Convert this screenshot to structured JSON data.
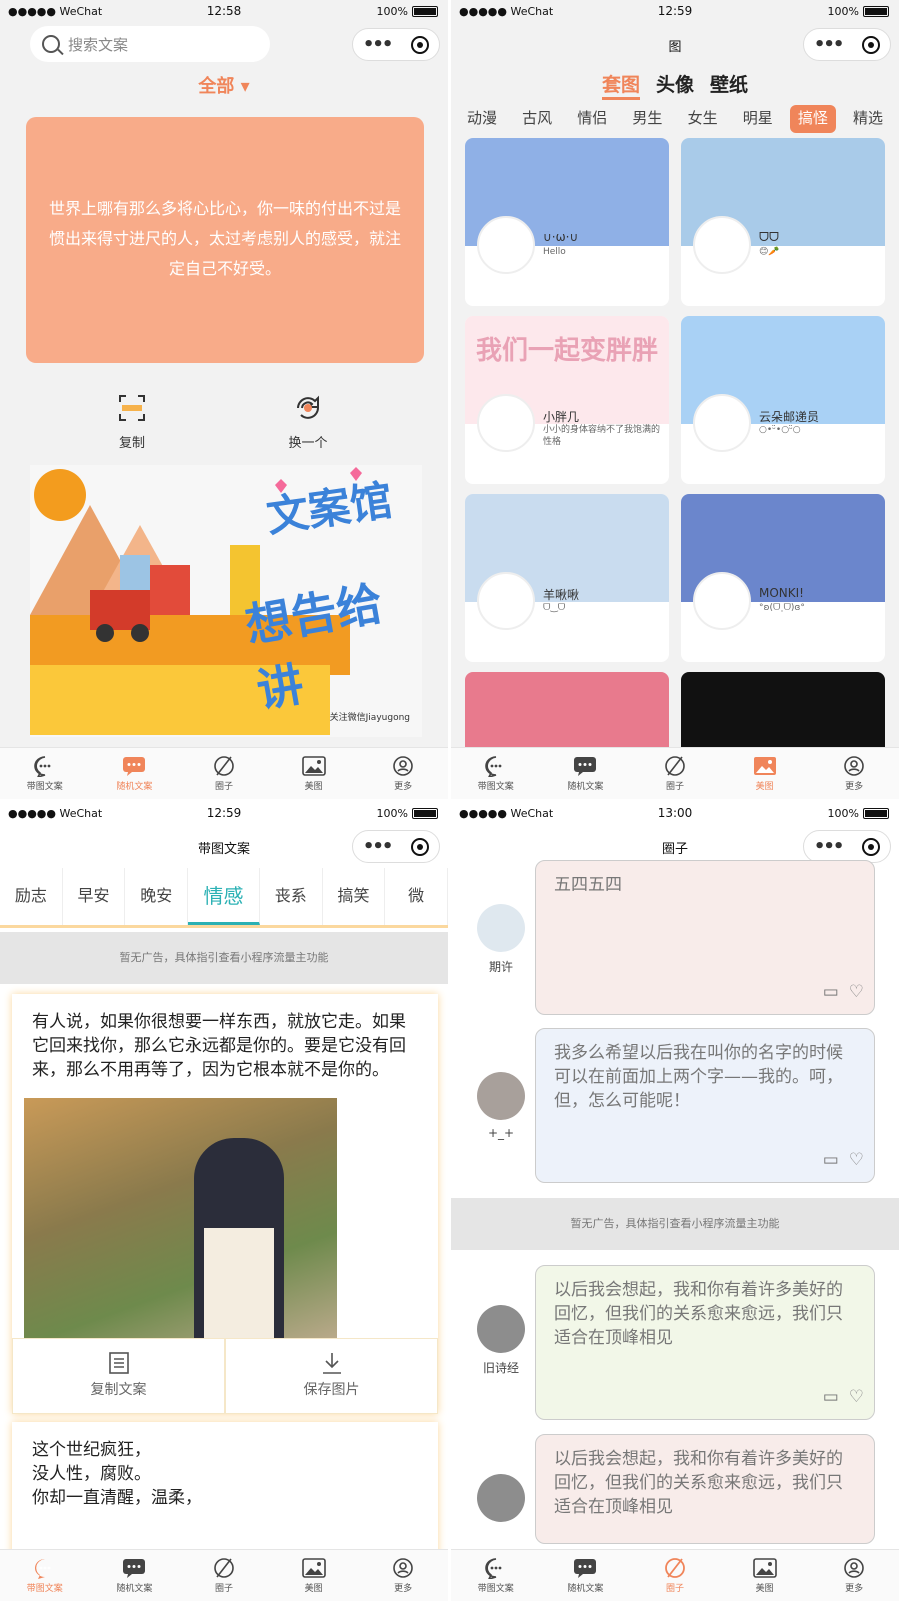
{
  "status": {
    "p1": {
      "signal": "●●●●● WeChat",
      "time": "12:58",
      "battery": "100%"
    },
    "p2": {
      "signal": "●●●●● WeChat",
      "time": "12:59",
      "battery": "100%"
    },
    "p3": {
      "signal": "●●●●● WeChat",
      "time": "12:59",
      "battery": "100%"
    },
    "p4": {
      "signal": "●●●●● WeChat",
      "time": "13:00",
      "battery": "100%"
    }
  },
  "tabbar": [
    "带图文案",
    "随机文案",
    "圈子",
    "美图",
    "更多"
  ],
  "p1": {
    "search_placeholder": "搜索文案",
    "category": "全部 ▾",
    "quote": "世界上哪有那么多将心比心，你一味的付出不过是惯出来得寸进尺的人，太过考虑别人的感受，就注定自己不好受。",
    "copy": "复制",
    "next": "换一个",
    "banner_title1": "文案馆",
    "banner_title2": "想告给讲",
    "banner_credit": "关注微信Jiayugong"
  },
  "p2": {
    "title": "图",
    "big_tabs": [
      "套图",
      "头像",
      "壁纸"
    ],
    "sub_tabs": [
      "动漫",
      "古风",
      "情侣",
      "男生",
      "女生",
      "明星",
      "搞怪",
      "精选"
    ],
    "cards": [
      {
        "name": "∪·ω·∪",
        "sign": "Hello"
      },
      {
        "name": "ᗜᗜ",
        "sign": "😊🥕"
      },
      {
        "name": "小胖几",
        "sign": "小小的身体容纳不了我饱满的性格",
        "cover_text": "我们一起变胖胖"
      },
      {
        "name": "云朵邮递员",
        "sign": "○•ᵕ̈•○ᵕ̈○"
      },
      {
        "name": "羊啾啾",
        "sign": "ᗜ‿ᗜ"
      },
      {
        "name": "MONKI!",
        "sign": "°ʚ(ᗜ˰ᗜ)ɞ°"
      }
    ],
    "colors": [
      "#8fb0e6",
      "#a9cbe9",
      "#fde8ec",
      "#a9d1f5",
      "#c9dcef",
      "#dce3f7",
      "#e87a8d",
      "#111111"
    ]
  },
  "p3": {
    "title": "带图文案",
    "tabs": [
      "励志",
      "早安",
      "晚安",
      "情感",
      "丧系",
      "搞笑",
      "微"
    ],
    "ad": "暂无广告，具体指引查看小程序流量主功能",
    "post1": "有人说，如果你很想要一样东西，就放它走。如果它回来找你，那么它永远都是你的。要是它没有回来，那么不用再等了，因为它根本就不是你的。",
    "copy_btn": "复制文案",
    "save_btn": "保存图片",
    "post2_lines": [
      "这个世纪疯狂，",
      "没人性，腐败。",
      "你却一直清醒，温柔，"
    ]
  },
  "p4": {
    "title": "圈子",
    "ad": "暂无广告，具体指引查看小程序流量主功能",
    "items": [
      {
        "user": "期许",
        "text": "五四五四",
        "bg": "#f8ecea"
      },
      {
        "user": "+_+",
        "text": "我多么希望以后我在叫你的名字的时候可以在前面加上两个字——我的。呵，但，怎么可能呢！",
        "bg": "#edf2fa"
      },
      {
        "user": "旧诗经",
        "text": "以后我会想起，我和你有着许多美好的回忆，但我们的关系愈来愈远，我们只适合在顶峰相见",
        "bg": "#f2f7e8"
      },
      {
        "user": "",
        "text": "以后我会想起，我和你有着许多美好的回忆，但我们的关系愈来愈远，我们只适合在顶峰相见",
        "bg": "#f8ecea"
      }
    ]
  }
}
